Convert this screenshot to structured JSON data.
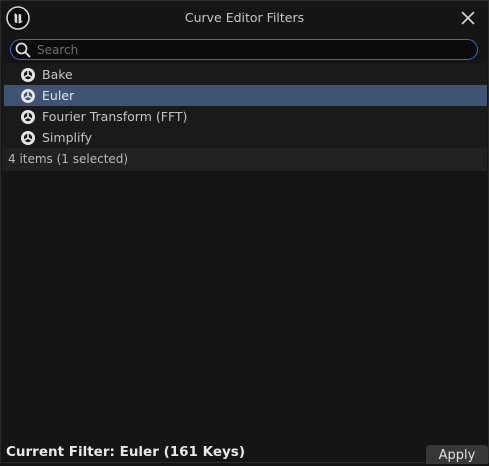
{
  "window": {
    "title": "Curve Editor Filters",
    "logo_icon": "unreal-engine-logo",
    "close_icon": "close-icon"
  },
  "search": {
    "placeholder": "Search",
    "value": ""
  },
  "filters": {
    "items": [
      {
        "label": "Bake",
        "icon": "filter-class-icon",
        "selected": false
      },
      {
        "label": "Euler",
        "icon": "filter-class-icon",
        "selected": true
      },
      {
        "label": "Fourier Transform (FFT)",
        "icon": "filter-class-icon",
        "selected": false
      },
      {
        "label": "Simplify",
        "icon": "filter-class-icon",
        "selected": false
      }
    ],
    "status": "4 items (1 selected)"
  },
  "footer": {
    "current_filter": "Current Filter: Euler (161 Keys)",
    "apply_label": "Apply"
  },
  "colors": {
    "selection": "#3f5474",
    "search_border": "#2b6bd6",
    "background": "#151515"
  }
}
